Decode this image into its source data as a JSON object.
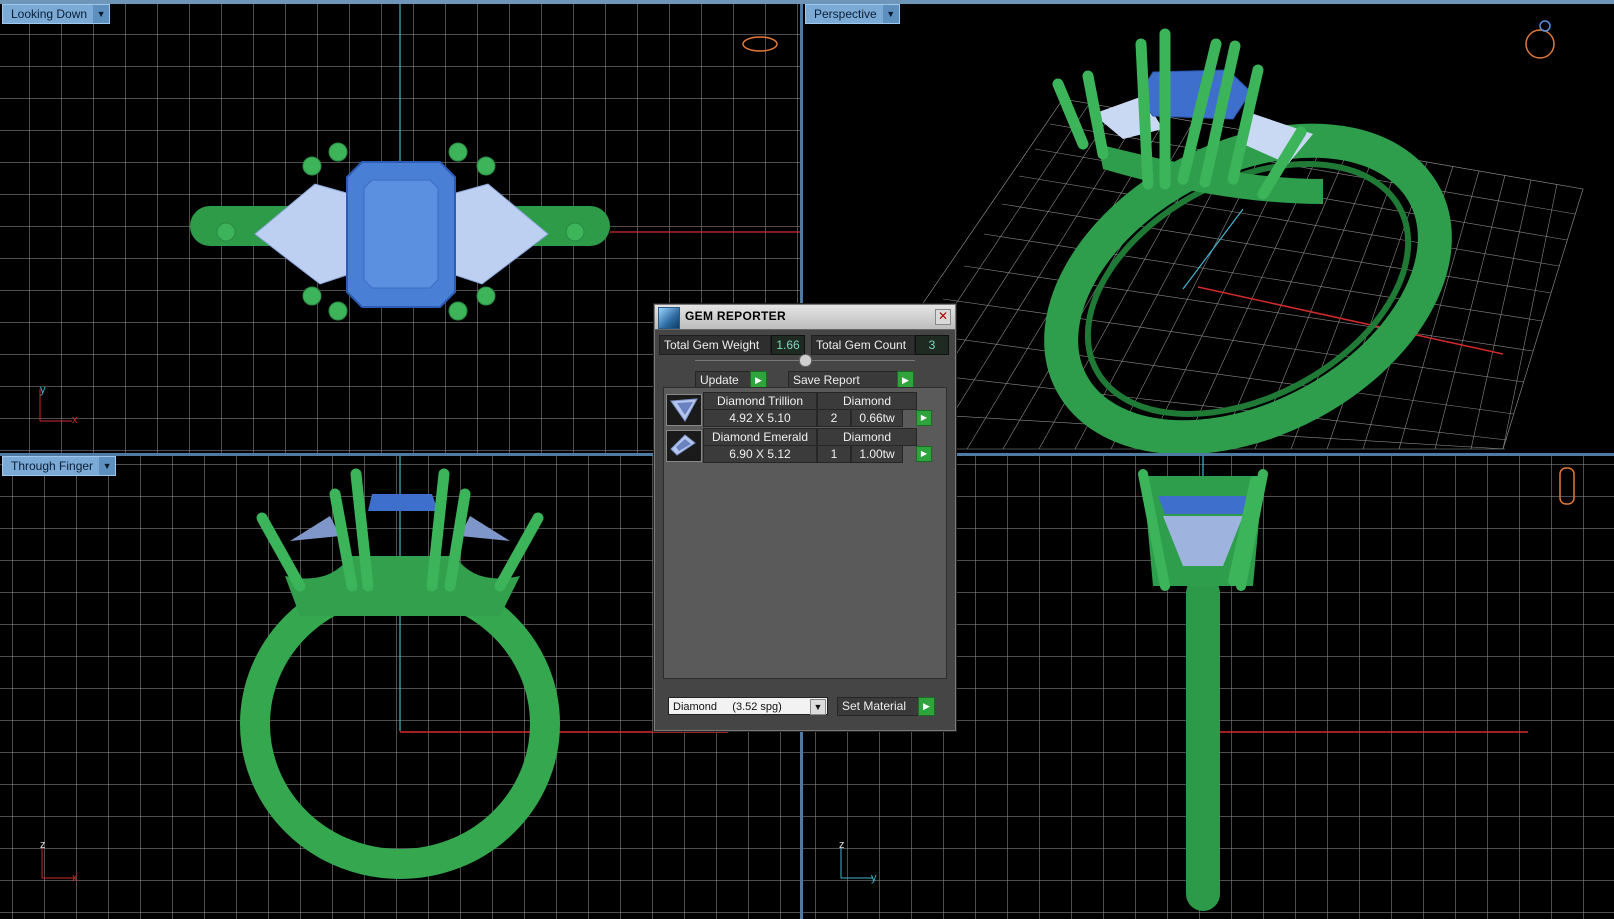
{
  "viewports": {
    "top_left": {
      "label": "Looking Down",
      "axis_a": "y",
      "axis_b": "x"
    },
    "top_right": {
      "label": "Perspective"
    },
    "bottom_left": {
      "label": "Through Finger",
      "axis_a": "z",
      "axis_b": "x"
    },
    "bottom_right": {
      "label": "",
      "axis_a": "z",
      "axis_b": "y"
    }
  },
  "gem_reporter": {
    "title": "GEM REPORTER",
    "total_weight_label": "Total Gem Weight",
    "total_weight_value": "1.66",
    "total_count_label": "Total Gem Count",
    "total_count_value": "3",
    "update_label": "Update",
    "save_report_label": "Save Report",
    "gems": [
      {
        "name": "Diamond Trillion",
        "material": "Diamond",
        "size": "4.92 X 5.10",
        "count": "2",
        "weight": "0.66tw",
        "icon": "trillion-gem-icon"
      },
      {
        "name": "Diamond Emerald",
        "material": "Diamond",
        "size": "6.90 X 5.12",
        "count": "1",
        "weight": "1.00tw",
        "icon": "emerald-gem-icon"
      }
    ],
    "material_select": "Diamond     (3.52 spg)",
    "set_material_label": "Set Material"
  },
  "colors": {
    "metal": "#3db35a",
    "center_stone": "#4a7fd6",
    "side_stone": "#b9ccef",
    "x_axis": "#d22a2a",
    "y_axis": "#3fb8d0",
    "viewport_label": "#7aaad5"
  }
}
